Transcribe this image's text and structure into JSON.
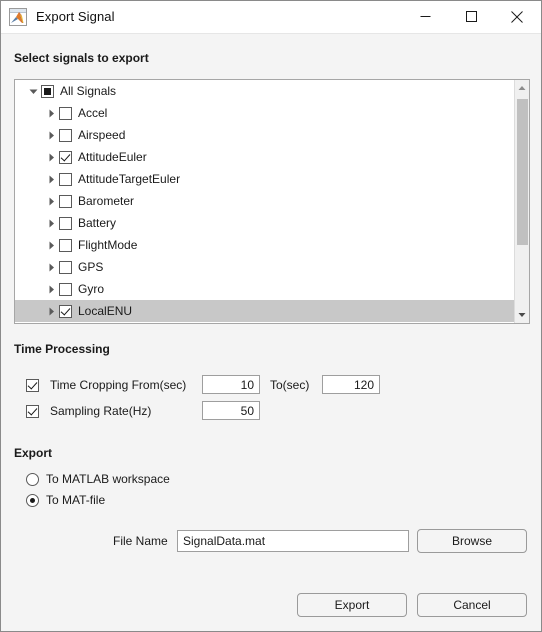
{
  "window": {
    "title": "Export Signal",
    "icon": "matlab-membrane-icon",
    "controls": {
      "minimize": "minimize-icon",
      "maximize": "maximize-icon",
      "close": "close-icon"
    }
  },
  "sections": {
    "select_signals_label": "Select signals to export",
    "time_processing_label": "Time Processing",
    "export_label": "Export"
  },
  "signal_tree": {
    "nodes": [
      {
        "label": "All Signals",
        "depth": 0,
        "check": "partial",
        "expander": "down",
        "selected": false
      },
      {
        "label": "Accel",
        "depth": 1,
        "check": "unchecked",
        "expander": "right",
        "selected": false
      },
      {
        "label": "Airspeed",
        "depth": 1,
        "check": "unchecked",
        "expander": "right",
        "selected": false
      },
      {
        "label": "AttitudeEuler",
        "depth": 1,
        "check": "checked",
        "expander": "right",
        "selected": false
      },
      {
        "label": "AttitudeTargetEuler",
        "depth": 1,
        "check": "unchecked",
        "expander": "right",
        "selected": false
      },
      {
        "label": "Barometer",
        "depth": 1,
        "check": "unchecked",
        "expander": "right",
        "selected": false
      },
      {
        "label": "Battery",
        "depth": 1,
        "check": "unchecked",
        "expander": "right",
        "selected": false
      },
      {
        "label": "FlightMode",
        "depth": 1,
        "check": "unchecked",
        "expander": "right",
        "selected": false
      },
      {
        "label": "GPS",
        "depth": 1,
        "check": "unchecked",
        "expander": "right",
        "selected": false
      },
      {
        "label": "Gyro",
        "depth": 1,
        "check": "unchecked",
        "expander": "right",
        "selected": false
      },
      {
        "label": "LocalENU",
        "depth": 1,
        "check": "checked",
        "expander": "right",
        "selected": true
      }
    ],
    "scrollbar": {
      "up_arrow": "scroll-up-icon",
      "down_arrow": "scroll-down-icon"
    }
  },
  "time_processing": {
    "cropping": {
      "checked": true,
      "label": "Time Cropping From(sec)",
      "from_value": "10",
      "to_label": "To(sec)",
      "to_value": "120"
    },
    "sampling": {
      "checked": true,
      "label": "Sampling Rate(Hz)",
      "value": "50"
    }
  },
  "export": {
    "destination_options": [
      {
        "label": "To MATLAB workspace",
        "selected": false
      },
      {
        "label": "To MAT-file",
        "selected": true
      }
    ],
    "file_name_label": "File Name",
    "file_name_value": "SignalData.mat",
    "file_name_placeholder": "",
    "browse_label": "Browse"
  },
  "footer": {
    "export_label": "Export",
    "cancel_label": "Cancel"
  },
  "colors": {
    "dialog_background": "#f4f4f4",
    "titlebar_background": "#ffffff",
    "field_background": "#ffffff",
    "selection_background": "#c8c8c8",
    "border": "#a6a6a6",
    "text": "#1a1a1a"
  }
}
